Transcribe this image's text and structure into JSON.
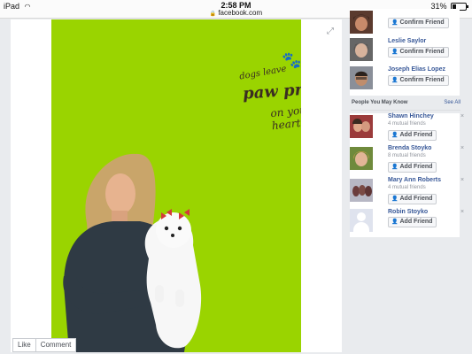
{
  "status_bar": {
    "device": "iPad",
    "wifi_icon": "wifi-icon",
    "time": "2:58 PM",
    "url": "facebook.com",
    "battery": "31%",
    "battery_level": 0.31
  },
  "photo_viewer": {
    "decal": {
      "line1": "dogs leave",
      "line2": "paw prints",
      "line3": "on your heart"
    },
    "like_label": "Like",
    "comment_label": "Comment"
  },
  "friend_requests": [
    {
      "name": "",
      "button": "Confirm Friend"
    },
    {
      "name": "Leslie Saylor",
      "button": "Confirm Friend"
    },
    {
      "name": "Joseph Elias Lopez",
      "button": "Confirm Friend"
    }
  ],
  "people_you_may_know": {
    "title": "People You May Know",
    "see_all": "See All",
    "people": [
      {
        "name": "Shawn Hinchey",
        "mutual": "4 mutual friends",
        "button": "Add Friend"
      },
      {
        "name": "Brenda Stoyko",
        "mutual": "8 mutual friends",
        "button": "Add Friend"
      },
      {
        "name": "Mary Ann Roberts",
        "mutual": "4 mutual friends",
        "button": "Add Friend"
      },
      {
        "name": "Robin Stoyko",
        "mutual": "",
        "button": "Add Friend"
      }
    ],
    "close_symbol": "×"
  },
  "colors": {
    "link": "#385898",
    "photo_wall": "#9ad400",
    "page_bg": "#e9ebee"
  }
}
